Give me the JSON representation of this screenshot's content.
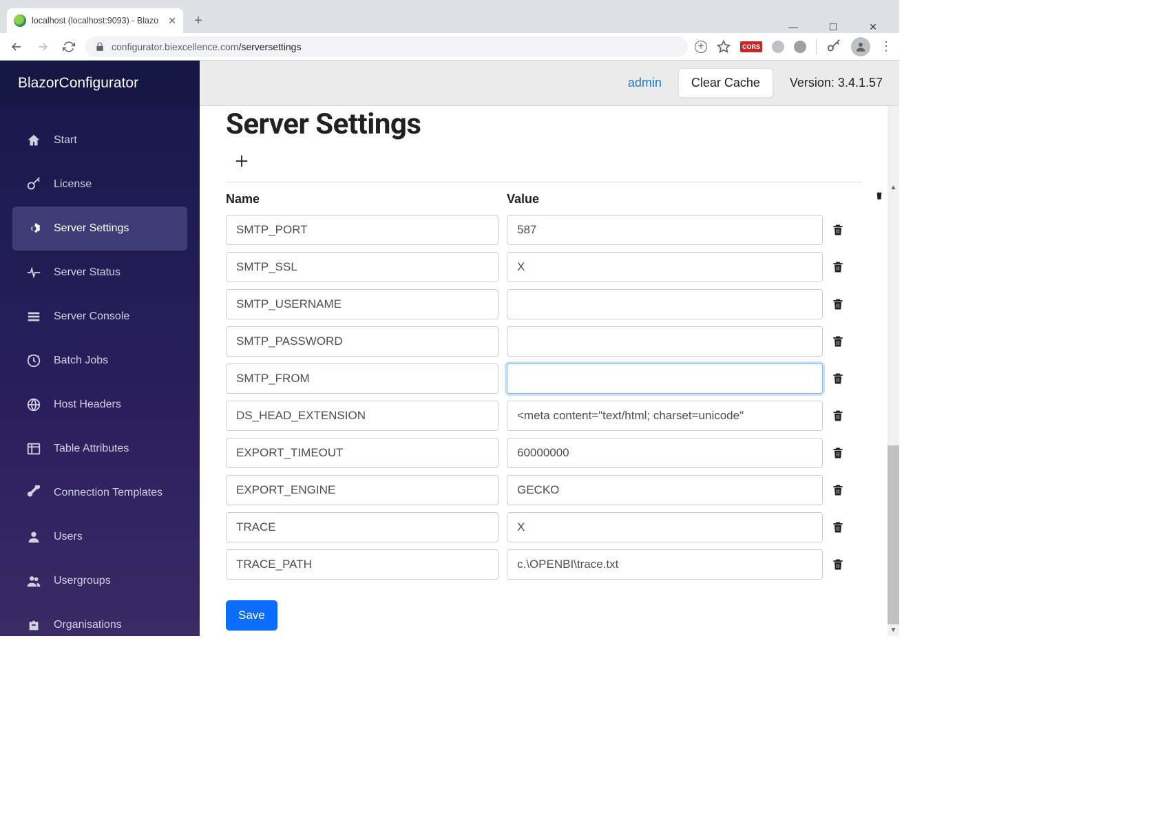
{
  "browser": {
    "tab_title": "localhost (localhost:9093) - Blazo",
    "url_host": "configurator.biexcellence.com",
    "url_path": "/serversettings",
    "ext_badge": "CORS"
  },
  "brand": "BlazorConfigurator",
  "topbar": {
    "admin": "admin",
    "clear_cache": "Clear Cache",
    "version": "Version: 3.4.1.57"
  },
  "sidebar": {
    "items": [
      {
        "label": "Start",
        "active": false
      },
      {
        "label": "License",
        "active": false
      },
      {
        "label": "Server Settings",
        "active": true
      },
      {
        "label": "Server Status",
        "active": false
      },
      {
        "label": "Server Console",
        "active": false
      },
      {
        "label": "Batch Jobs",
        "active": false
      },
      {
        "label": "Host Headers",
        "active": false
      },
      {
        "label": "Table Attributes",
        "active": false
      },
      {
        "label": "Connection Templates",
        "active": false
      },
      {
        "label": "Users",
        "active": false
      },
      {
        "label": "Usergroups",
        "active": false
      },
      {
        "label": "Organisations",
        "active": false
      }
    ]
  },
  "page": {
    "title": "Server Settings",
    "col_name": "Name",
    "col_value": "Value",
    "save": "Save",
    "rows": [
      {
        "name": "SMTP_PORT",
        "value": "587",
        "focused": false
      },
      {
        "name": "SMTP_SSL",
        "value": "X",
        "focused": false
      },
      {
        "name": "SMTP_USERNAME",
        "value": "",
        "focused": false
      },
      {
        "name": "SMTP_PASSWORD",
        "value": "",
        "focused": false
      },
      {
        "name": "SMTP_FROM",
        "value": "",
        "focused": true
      },
      {
        "name": "DS_HEAD_EXTENSION",
        "value": "<meta content=\"text/html; charset=unicode\"",
        "focused": false
      },
      {
        "name": "EXPORT_TIMEOUT",
        "value": "60000000",
        "focused": false
      },
      {
        "name": "EXPORT_ENGINE",
        "value": "GECKO",
        "focused": false
      },
      {
        "name": "TRACE",
        "value": "X",
        "focused": false
      },
      {
        "name": "TRACE_PATH",
        "value": "c.\\OPENBI\\trace.txt",
        "focused": false
      }
    ]
  }
}
